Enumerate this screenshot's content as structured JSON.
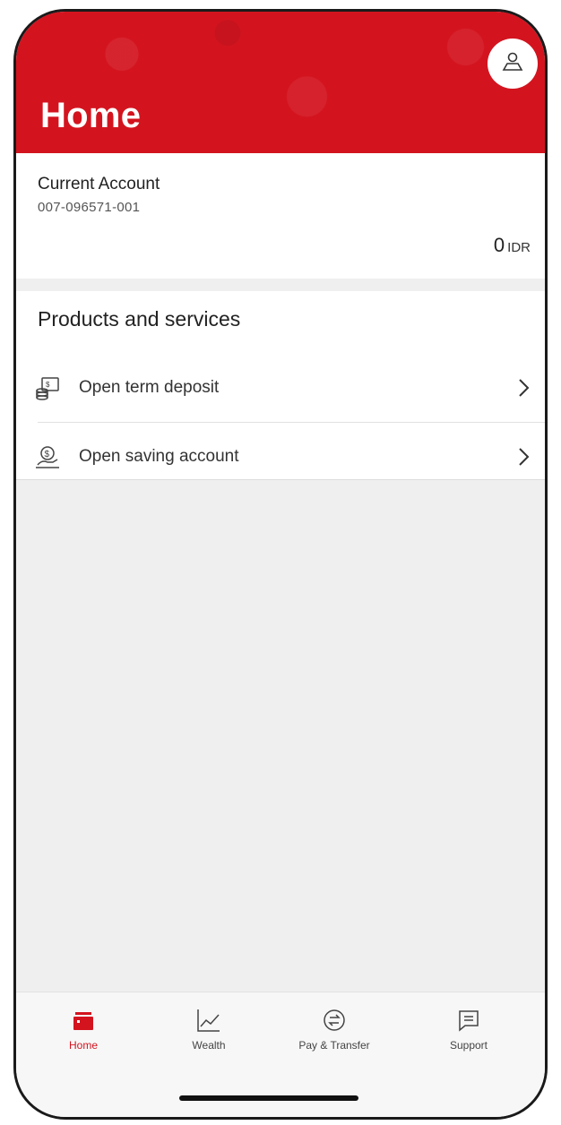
{
  "header": {
    "title": "Home",
    "profile_icon": "user-icon",
    "color": "#d3141f"
  },
  "account": {
    "name": "Current Account",
    "number": "007-096571-001",
    "balance": "0",
    "currency": "IDR"
  },
  "products": {
    "title": "Products and services",
    "items": [
      {
        "label": "Open term deposit",
        "icon": "term-deposit-icon"
      },
      {
        "label": "Open saving account",
        "icon": "saving-account-icon"
      }
    ]
  },
  "tabs": [
    {
      "label": "Home",
      "icon": "home-wallet-icon",
      "active": true
    },
    {
      "label": "Wealth",
      "icon": "chart-line-icon",
      "active": false
    },
    {
      "label": "Pay & Transfer",
      "icon": "transfer-icon",
      "active": false
    },
    {
      "label": "Support",
      "icon": "chat-icon",
      "active": false
    }
  ]
}
